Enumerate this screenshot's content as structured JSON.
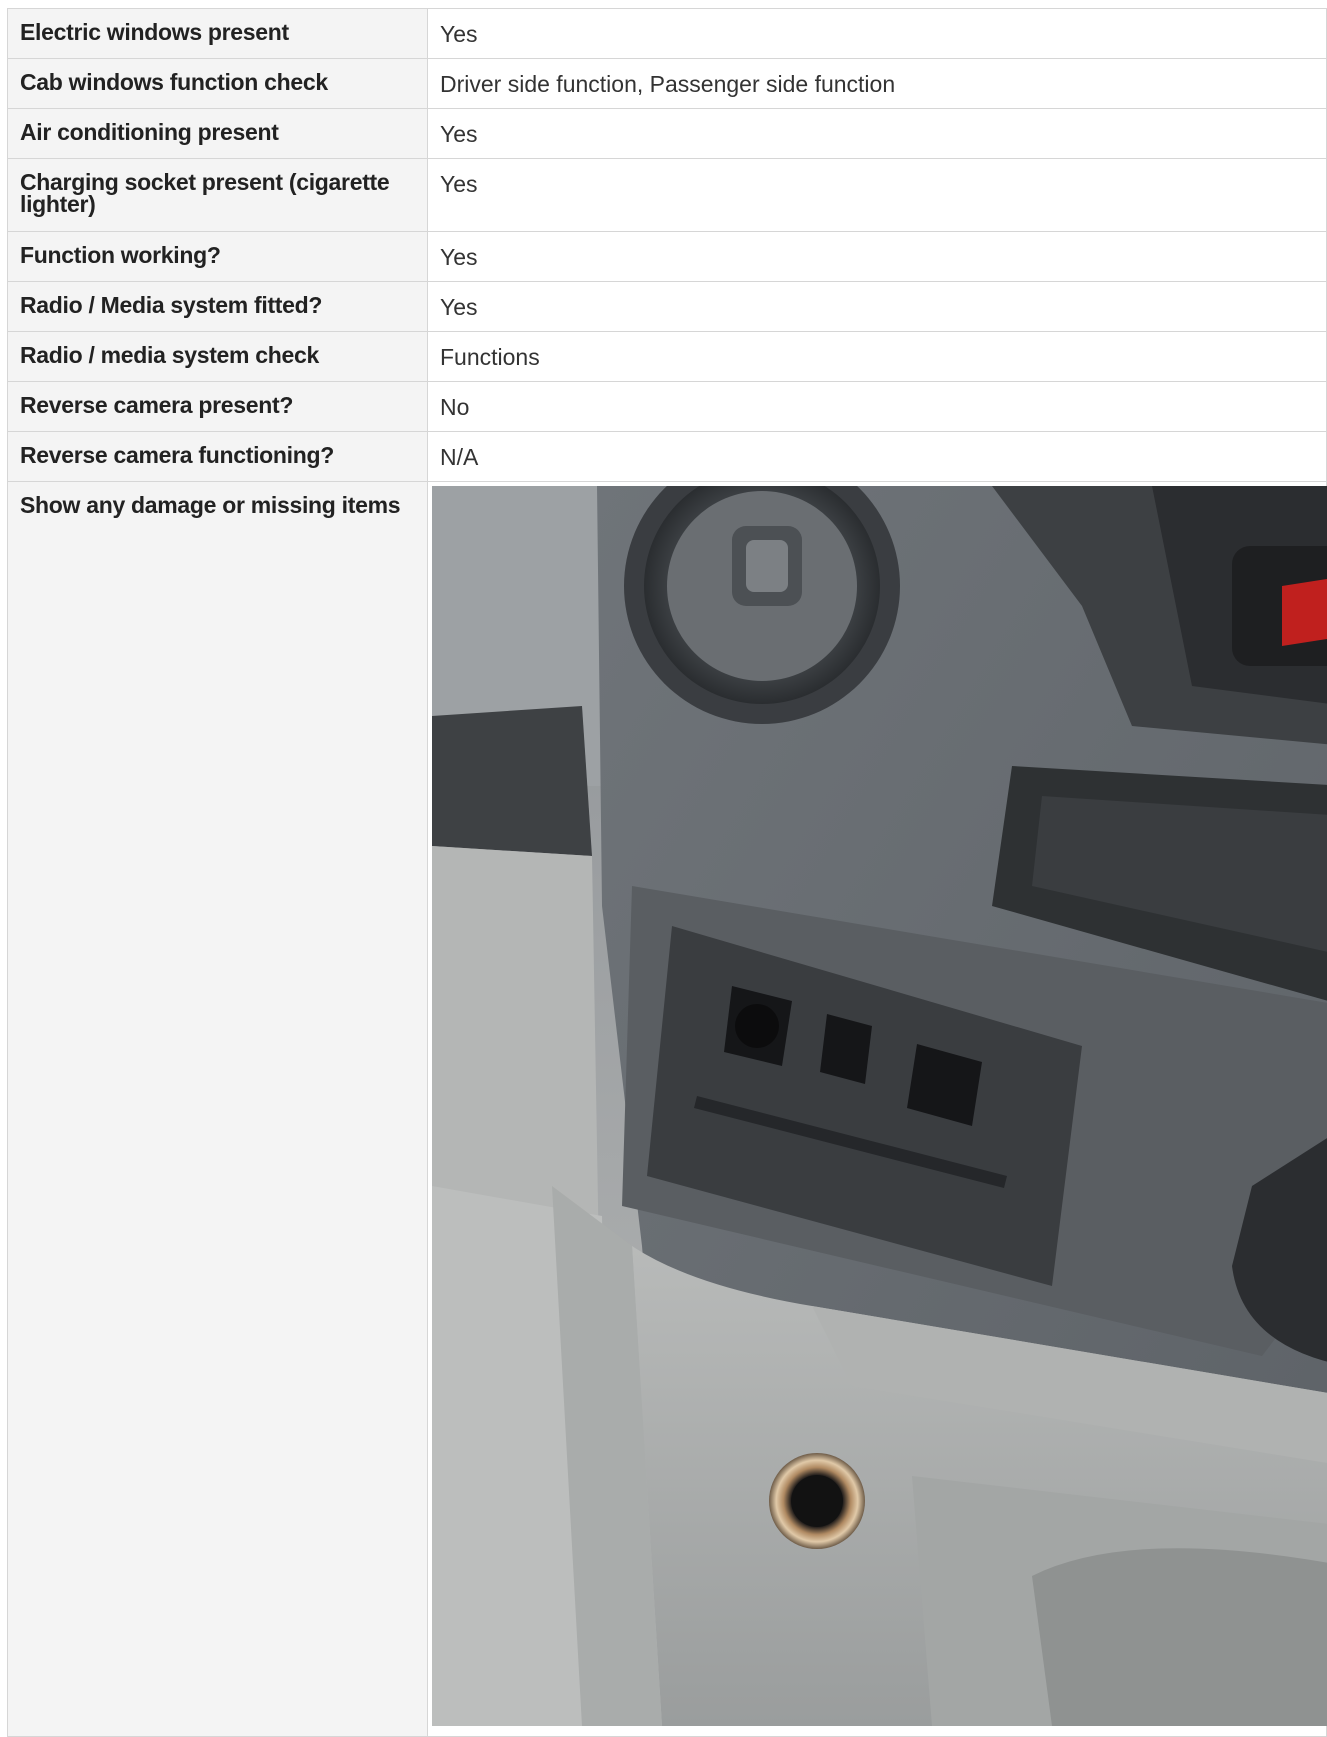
{
  "rows": [
    {
      "label": "Electric windows present",
      "value": "Yes"
    },
    {
      "label": "Cab windows function check",
      "value": "Driver side function, Passenger side function"
    },
    {
      "label": "Air conditioning present",
      "value": "Yes"
    },
    {
      "label": "Charging socket present (cigarette lighter)",
      "value": "Yes"
    },
    {
      "label": "Function working?",
      "value": "Yes"
    },
    {
      "label": "Radio / Media system fitted?",
      "value": "Yes"
    },
    {
      "label": "Radio / media system check",
      "value": "Functions"
    },
    {
      "label": "Reverse camera present?",
      "value": "No"
    },
    {
      "label": "Reverse camera functioning?",
      "value": "N/A"
    }
  ],
  "damage": {
    "label": "Show any damage or missing items",
    "photo_icon": "dashboard-photo"
  }
}
